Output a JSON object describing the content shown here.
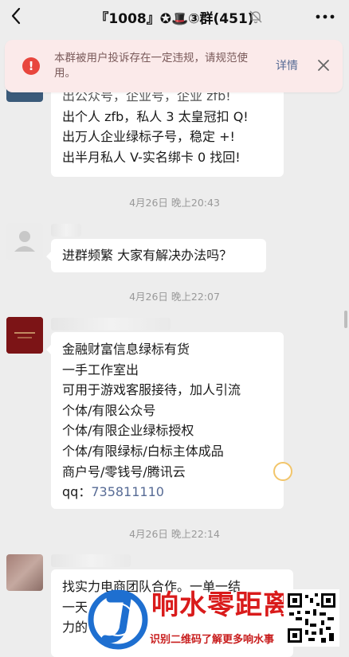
{
  "header": {
    "title": "『1008』✪🎩③群(451)",
    "back_icon": "chevron-left-icon",
    "mute_icon": "bell-muted-icon",
    "more_icon": "more-dots-icon"
  },
  "banner": {
    "text": "本群被用户投诉存在一定违规，请规范使用。",
    "detail_label": "详情",
    "alert_icon": "alert-icon",
    "alert_mark": "!",
    "close_icon": "close-icon"
  },
  "messages": [
    {
      "lines": [
        "出公众号，企业号，企业 zfb!",
        "出个人 zfb，私人 3 太皇冠扣 Q!",
        "出万人企业绿标子号，稳定 +!",
        "出半月私人 V-实名绑卡 0 找回!"
      ]
    },
    {
      "timestamp": "4月26日 晚上20:43",
      "lines": [
        "进群频繁 大家有解决办法吗？"
      ]
    },
    {
      "timestamp": "4月26日 晚上22:07",
      "lines": [
        "金融财富信息绿标有货",
        "一手工作室出",
        "可用于游戏客服接待，加人引流",
        "个体/有限公众号",
        "个体/有限企业绿标授权",
        "个体/有限绿标/白标主体成品",
        "商户号/零钱号/腾讯云"
      ],
      "qq_label": "qq：",
      "qq_number": "735811110"
    },
    {
      "timestamp": "4月26日 晚上22:14",
      "lines": [
        "找实力电商团队合作。一单一结",
        "一天",
        "力的"
      ]
    }
  ],
  "watermark": {
    "brand": "响水零距离",
    "tagline": "识别二维码了解更多响水事"
  },
  "colors": {
    "background": "#ededed",
    "alert_red": "#e8463d",
    "link_blue": "#576b95",
    "watermark_red": "#d91b1b"
  }
}
